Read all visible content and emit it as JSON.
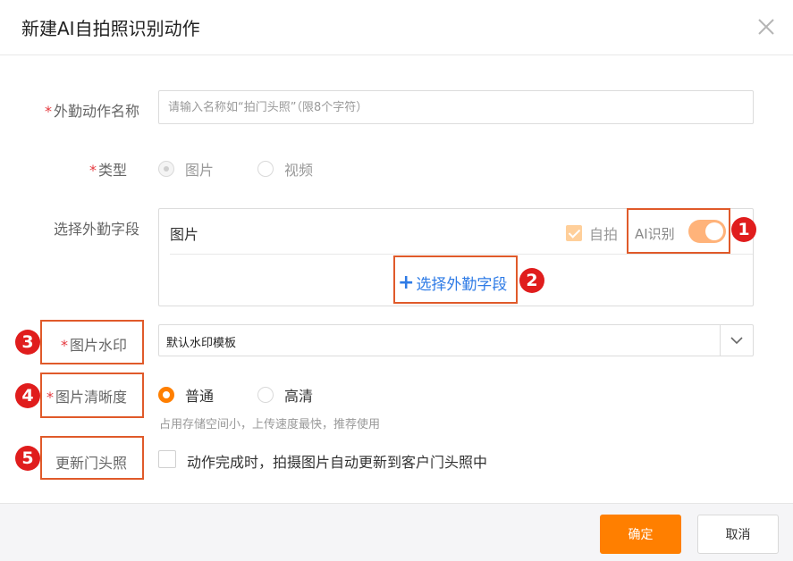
{
  "dialog": {
    "title": "新建AI自拍照识别动作",
    "close_icon": "close-icon"
  },
  "form": {
    "required_mark": "*",
    "name": {
      "label": "外勤动作名称",
      "placeholder": "请输入名称如“拍门头照”（限8个字符）",
      "value": ""
    },
    "type": {
      "label": "类型",
      "options": [
        "图片",
        "视频"
      ],
      "selected": "图片",
      "disabled": true
    },
    "fields": {
      "label": "选择外勤字段",
      "field_name": "图片",
      "selfie_label": "自拍",
      "selfie_checked": true,
      "ai_label": "AI识别",
      "ai_enabled": true,
      "add_label": "选择外勤字段",
      "add_icon": "+"
    },
    "watermark": {
      "label": "图片水印",
      "value": "默认水印模板"
    },
    "clarity": {
      "label": "图片清晰度",
      "options": [
        "普通",
        "高清"
      ],
      "selected": "普通",
      "hint": "占用存储空间小，上传速度最快，推荐使用"
    },
    "update_photo": {
      "label": "更新门头照",
      "checkbox_label": "动作完成时，拍摄图片自动更新到客户门头照中",
      "checked": false
    }
  },
  "footer": {
    "confirm_label": "确定",
    "cancel_label": "取消"
  },
  "annotations": [
    "1",
    "2",
    "3",
    "4",
    "5"
  ],
  "colors": {
    "accent": "#ff7f00",
    "link": "#2e7be6",
    "required": "#e5393f",
    "annotation": "#e01d1d"
  }
}
